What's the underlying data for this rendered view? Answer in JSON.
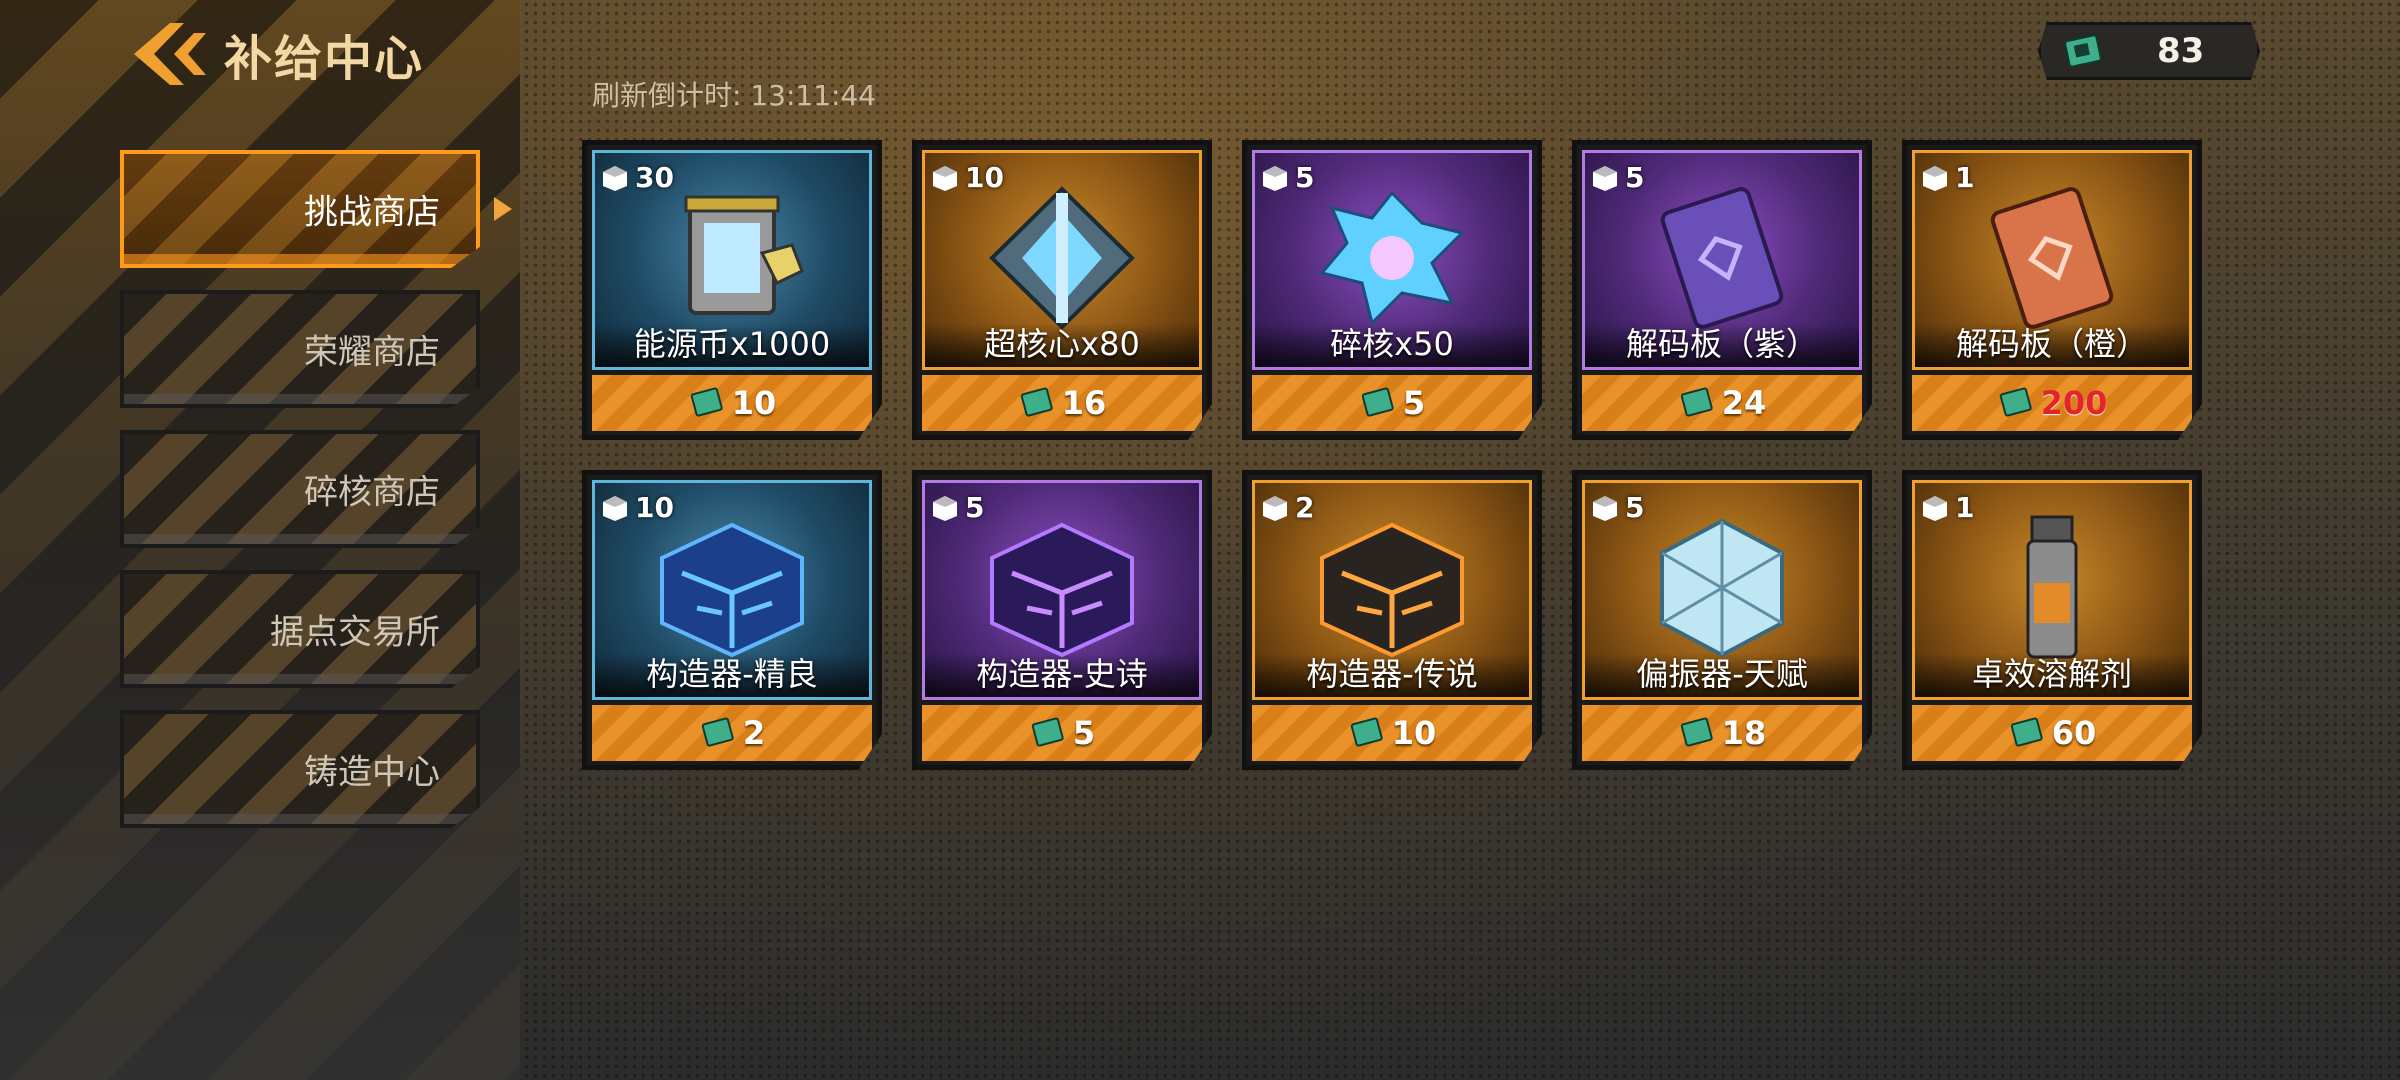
{
  "header": {
    "title": "补给中心",
    "refresh_label": "刷新倒计时: 13:11:44"
  },
  "currency": {
    "icon": "chip-card-icon",
    "value": "83"
  },
  "sidebar": {
    "items": [
      {
        "label": "挑战商店",
        "active": true
      },
      {
        "label": "荣耀商店",
        "active": false
      },
      {
        "label": "碎核商店",
        "active": false
      },
      {
        "label": "据点交易所",
        "active": false
      },
      {
        "label": "铸造中心",
        "active": false
      }
    ]
  },
  "shop": {
    "items": [
      {
        "stock": "30",
        "name": "能源币x1000",
        "price": "10",
        "rarity": "blue",
        "icon": "energy-coin-icon"
      },
      {
        "stock": "10",
        "name": "超核心x80",
        "price": "16",
        "rarity": "orange",
        "icon": "super-core-icon"
      },
      {
        "stock": "5",
        "name": "碎核x50",
        "price": "5",
        "rarity": "purple",
        "icon": "core-shard-icon"
      },
      {
        "stock": "5",
        "name": "解码板（紫）",
        "price": "24",
        "rarity": "purple",
        "icon": "decoder-board-purple-icon"
      },
      {
        "stock": "1",
        "name": "解码板（橙）",
        "price": "200",
        "rarity": "orange",
        "price_red": true,
        "icon": "decoder-board-orange-icon"
      },
      {
        "stock": "10",
        "name": "构造器-精良",
        "price": "2",
        "rarity": "blue",
        "icon": "constructor-blue-icon"
      },
      {
        "stock": "5",
        "name": "构造器-史诗",
        "price": "5",
        "rarity": "purple",
        "icon": "constructor-purple-icon"
      },
      {
        "stock": "2",
        "name": "构造器-传说",
        "price": "10",
        "rarity": "orange",
        "icon": "constructor-orange-icon"
      },
      {
        "stock": "5",
        "name": "偏振器-天赋",
        "price": "18",
        "rarity": "orange",
        "icon": "polarizer-icon"
      },
      {
        "stock": "1",
        "name": "卓效溶解剂",
        "price": "60",
        "rarity": "orange",
        "icon": "dissolvent-icon"
      }
    ]
  },
  "colors": {
    "accent": "#ff9a1a",
    "blue": "#5fb6d8",
    "purple": "#b37ae6",
    "orange": "#f0a030",
    "price_red": "#e3242b"
  }
}
